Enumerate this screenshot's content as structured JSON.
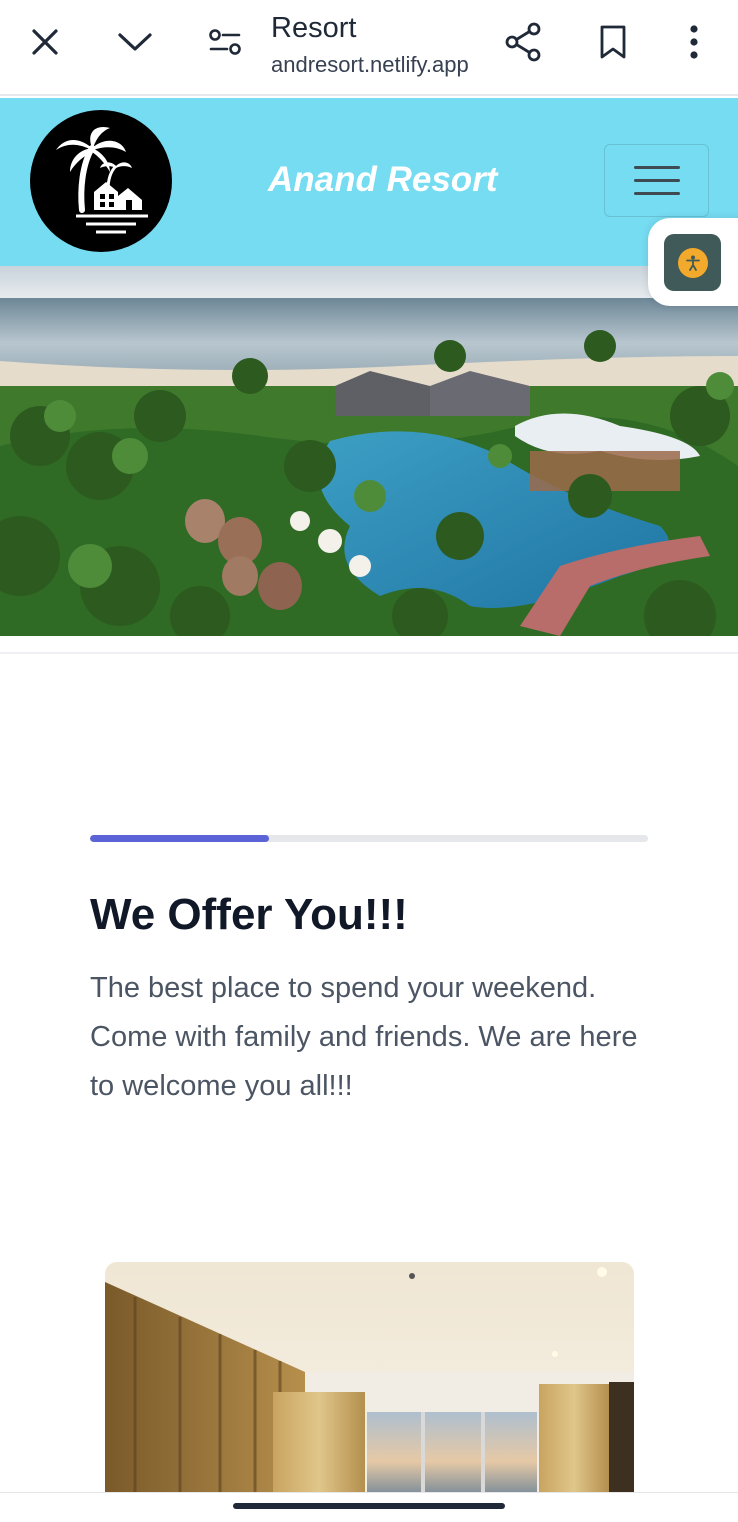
{
  "browser": {
    "title": "Resort",
    "url": "andresort.netlify.app",
    "icons": [
      "close-icon",
      "chevron-down-icon",
      "site-settings-icon",
      "share-icon",
      "bookmark-icon",
      "more-vert-icon"
    ]
  },
  "site": {
    "brand": "Anand Resort",
    "header_color": "#76dcf1",
    "accent": "#5b63d6"
  },
  "content": {
    "progress": 0.32,
    "heading": "We Offer You!!!",
    "paragraph": "The best place to spend your weekend. Come with family and friends. We are here to welcome you all!!!"
  }
}
